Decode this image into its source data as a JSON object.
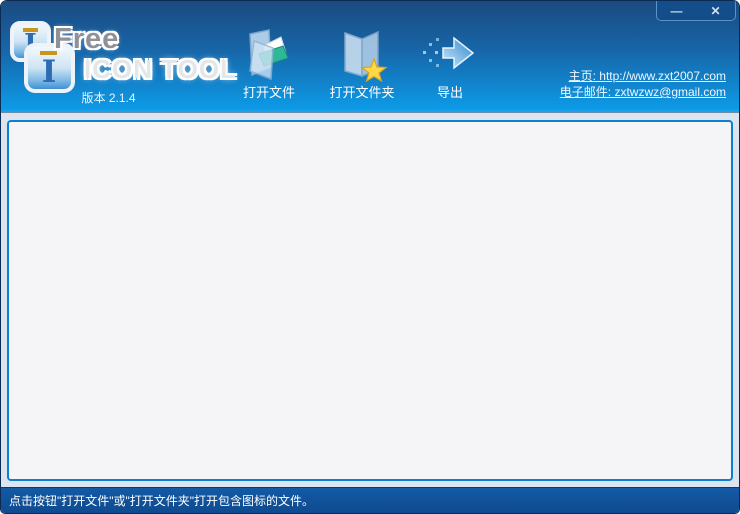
{
  "app": {
    "title_line1": "Free",
    "title_line2": "ICON TOOL",
    "version": "版本 2.1.4"
  },
  "toolbar": {
    "open_file_label": "打开文件",
    "open_folder_label": "打开文件夹",
    "export_label": "导出",
    "icons": [
      "open-file-folder-with-papers",
      "folder-with-star",
      "export-arrow-with-dots"
    ]
  },
  "links": {
    "homepage_label": "主页: http://www.zxt2007.com",
    "email_label": "电子邮件: zxtwzwz@gmail.com"
  },
  "window_controls": {
    "minimize_glyph": "—",
    "close_glyph": "✕"
  },
  "statusbar": {
    "message": "点击按钮\"打开文件\"或\"打开文件夹\"打开包含图标的文件。"
  },
  "colors": {
    "header_top": "#1b4a80",
    "header_bottom": "#0d9be8",
    "header_edge": "#17a3ec",
    "frame_background": "#dce4ef",
    "panel_background": "#f5f5f8",
    "panel_border": "#0b80d0",
    "status_background": "#11539e",
    "link_color": "#f0f7ff",
    "label_color": "#ffffff",
    "star_color": "#ffd84a",
    "card_color": "#2fb898"
  }
}
